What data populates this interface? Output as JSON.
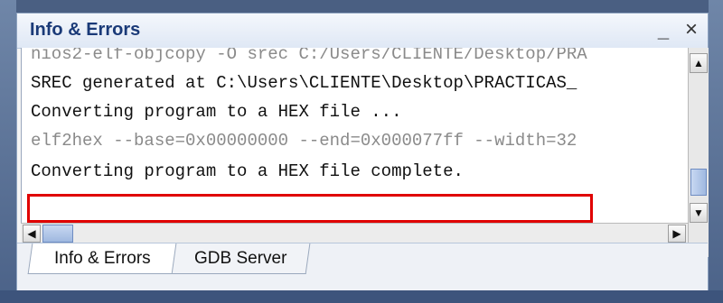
{
  "window": {
    "title": "Info & Errors",
    "minimize_label": "_",
    "close_label": "×"
  },
  "console": {
    "lines": [
      "nios2-elf-objcopy -O srec C:/Users/CLIENTE/Desktop/PRA",
      "SREC generated at C:\\Users\\CLIENTE\\Desktop\\PRACTICAS_",
      "Converting program to a HEX file ...",
      "elf2hex --base=0x00000000 --end=0x000077ff --width=32",
      "Converting program to a HEX file complete."
    ]
  },
  "tabs": [
    {
      "label": "Info & Errors"
    },
    {
      "label": "GDB Server"
    }
  ],
  "colors": {
    "highlight": "#e00000",
    "title_text": "#1a3a78"
  },
  "icons": {
    "scroll_up": "▲",
    "scroll_down": "▼",
    "scroll_left": "◀",
    "scroll_right": "▶"
  }
}
